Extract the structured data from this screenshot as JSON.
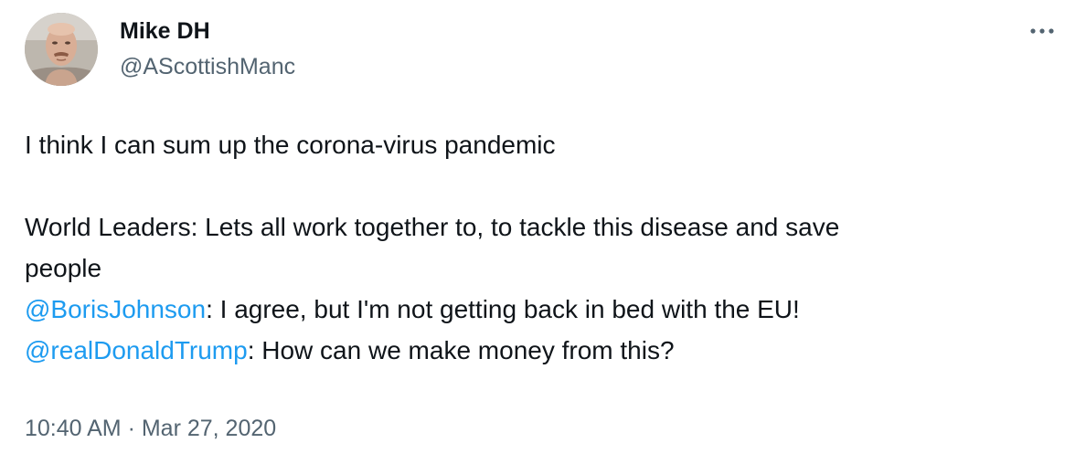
{
  "tweet": {
    "author": {
      "display_name": "Mike DH",
      "handle": "@AScottishManc",
      "avatar_icon": "profile-photo"
    },
    "more_icon": "more-options-icon",
    "body": {
      "line1": "I think I can sum up the corona-virus pandemic",
      "line2": "World Leaders: Lets all work together to, to tackle this disease and save",
      "line3": "people",
      "mention1": "@BorisJohnson",
      "line4_rest": ": I agree, but I'm not getting back in bed with the EU!",
      "mention2": "@realDonaldTrump",
      "line5_rest": ": How can we make money from this?"
    },
    "meta": {
      "time": "10:40 AM",
      "separator": " · ",
      "date": "Mar 27, 2020"
    },
    "colors": {
      "text": "#0f1419",
      "secondary": "#536471",
      "link": "#1d9bf0"
    }
  }
}
